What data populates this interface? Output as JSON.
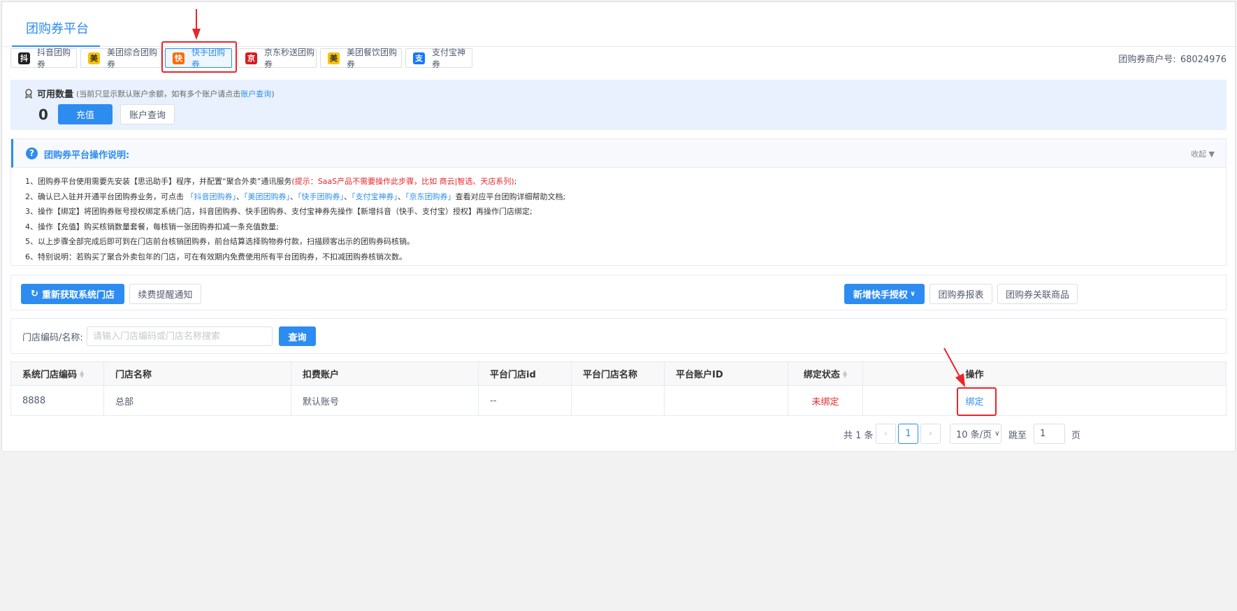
{
  "header": {
    "title": "团购券平台"
  },
  "tabs": [
    {
      "icon": "抖",
      "icon_color": "#222222",
      "label": "抖音团购券"
    },
    {
      "icon": "美",
      "icon_color": "#f7c200",
      "label": "美团综合团购券"
    },
    {
      "icon": "快",
      "icon_color": "#ff6a00",
      "label": "快手团购券",
      "active": true
    },
    {
      "icon": "京",
      "icon_color": "#d71c1e",
      "label": "京东秒送团购券"
    },
    {
      "icon": "美",
      "icon_color": "#f7c200",
      "label": "美团餐饮团购券"
    },
    {
      "icon": "支",
      "icon_color": "#1677ff",
      "label": "支付宝神券"
    }
  ],
  "merchant": {
    "label": "团购券商户号:",
    "value": "68024976"
  },
  "balance": {
    "label": "可用数量",
    "note_prefix": "(当前只显示默认账户余额，如有多个账户请点击",
    "note_link": "账户查询",
    "note_suffix": ")",
    "value": "0",
    "recharge_label": "充值",
    "query_label": "账户查询"
  },
  "instructions": {
    "title": "团购券平台操作说明:",
    "collapse_label": "收起 ▼",
    "line1_text": "1、团购券平台使用需要先安装【思迅助手】程序，并配置“聚合外卖”通讯服务",
    "line1_red": "(提示：SaaS产品不需要操作此步骤，比如 商云|智选、天店系列)",
    "line1_end": ";",
    "line2_a": "2、确认已入驻并开通平台团购券业务，可点击",
    "line2_links": [
      "「抖音团购券」",
      "「美团团购券」",
      "「快手团购券」",
      "「支付宝神券」",
      "「京东团购券」"
    ],
    "line2_sep": "、",
    "line2_b": "查看对应平台团购详细帮助文档;",
    "line3": "3、操作【绑定】将团购券账号授权绑定系统门店，抖音团购券、快手团购券、支付宝神券先操作【新增抖音（快手、支付宝）授权】再操作门店绑定;",
    "line4": "4、操作【充值】购买核销数量套餐，每核销一张团购券扣减一条充值数量;",
    "line5": "5、以上步骤全部完成后即可到在门店前台核销团购券，前台结算选择购物券付款，扫描顾客出示的团购券码核销。",
    "line6": "6、特别说明：若购买了聚合外卖包年的门店，可在有效期内免费使用所有平台团购券，不扣减团购券核销次数。"
  },
  "toolbar": {
    "refresh_label": "重新获取系统门店",
    "renew_label": "续费提醒通知",
    "add_auth_label": "新增快手授权",
    "report_label": "团购券报表",
    "goods_label": "团购券关联商品"
  },
  "search": {
    "label": "门店编码/名称:",
    "placeholder": "请输入门店编码或门店名称搜索",
    "button_label": "查询"
  },
  "table": {
    "columns": [
      "系统门店编码",
      "门店名称",
      "扣费账户",
      "平台门店id",
      "平台门店名称",
      "平台账户ID",
      "绑定状态",
      "操作"
    ],
    "rows": [
      {
        "code": "8888",
        "name": "总部",
        "account": "默认账号",
        "platform_store_id": "--",
        "platform_store_name": "",
        "platform_account_id": "",
        "status": "未绑定",
        "action": "绑定"
      }
    ]
  },
  "pagination": {
    "total": "共 1 条",
    "current": "1",
    "page_size": "10 条/页",
    "jump_label": "跳至",
    "jump_value": "1",
    "page_unit": "页"
  },
  "colors": {
    "primary": "#2d8cf0",
    "highlight": "#e8262a"
  }
}
